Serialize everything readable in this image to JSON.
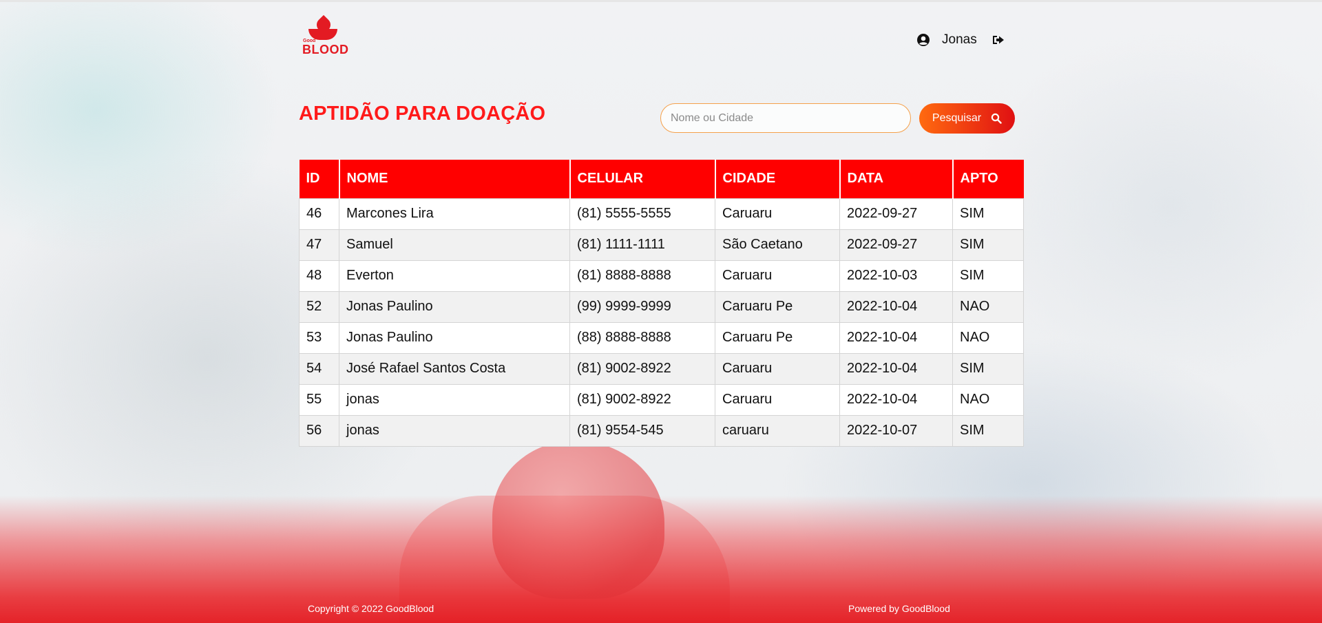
{
  "app": {
    "logo_small": "Good",
    "logo_text": "BLOOD",
    "brand_color": "#e31b23"
  },
  "header": {
    "user_name": "Jonas",
    "user_icon": "user-circle-icon",
    "logout_icon": "sign-out-icon"
  },
  "page": {
    "title": "APTIDÃO PARA DOAÇÃO"
  },
  "search": {
    "placeholder": "Nome ou Cidade",
    "value": "",
    "button_label": "Pesquisar",
    "button_icon": "search-icon"
  },
  "table": {
    "headers": [
      "ID",
      "NOME",
      "CELULAR",
      "CIDADE",
      "DATA",
      "APTO"
    ],
    "header_color": "#ff0000",
    "rows": [
      [
        "46",
        "Marcones Lira",
        "(81) 5555-5555",
        "Caruaru",
        "2022-09-27",
        "SIM"
      ],
      [
        "47",
        "Samuel",
        "(81) 1111-1111",
        "São Caetano",
        "2022-09-27",
        "SIM"
      ],
      [
        "48",
        "Everton",
        "(81) 8888-8888",
        "Caruaru",
        "2022-10-03",
        "SIM"
      ],
      [
        "52",
        "Jonas Paulino",
        "(99) 9999-9999",
        "Caruaru Pe",
        "2022-10-04",
        "NAO"
      ],
      [
        "53",
        "Jonas Paulino",
        "(88) 8888-8888",
        "Caruaru Pe",
        "2022-10-04",
        "NAO"
      ],
      [
        "54",
        "José Rafael Santos Costa",
        "(81) 9002-8922",
        "Caruaru",
        "2022-10-04",
        "SIM"
      ],
      [
        "55",
        "jonas",
        "(81) 9002-8922",
        "Caruaru",
        "2022-10-04",
        "NAO"
      ],
      [
        "56",
        "jonas",
        "(81) 9554-545",
        "caruaru",
        "2022-10-07",
        "SIM"
      ]
    ]
  },
  "footer": {
    "copyright": "Copyright © 2022 GoodBlood",
    "powered": "Powered by GoodBlood"
  }
}
